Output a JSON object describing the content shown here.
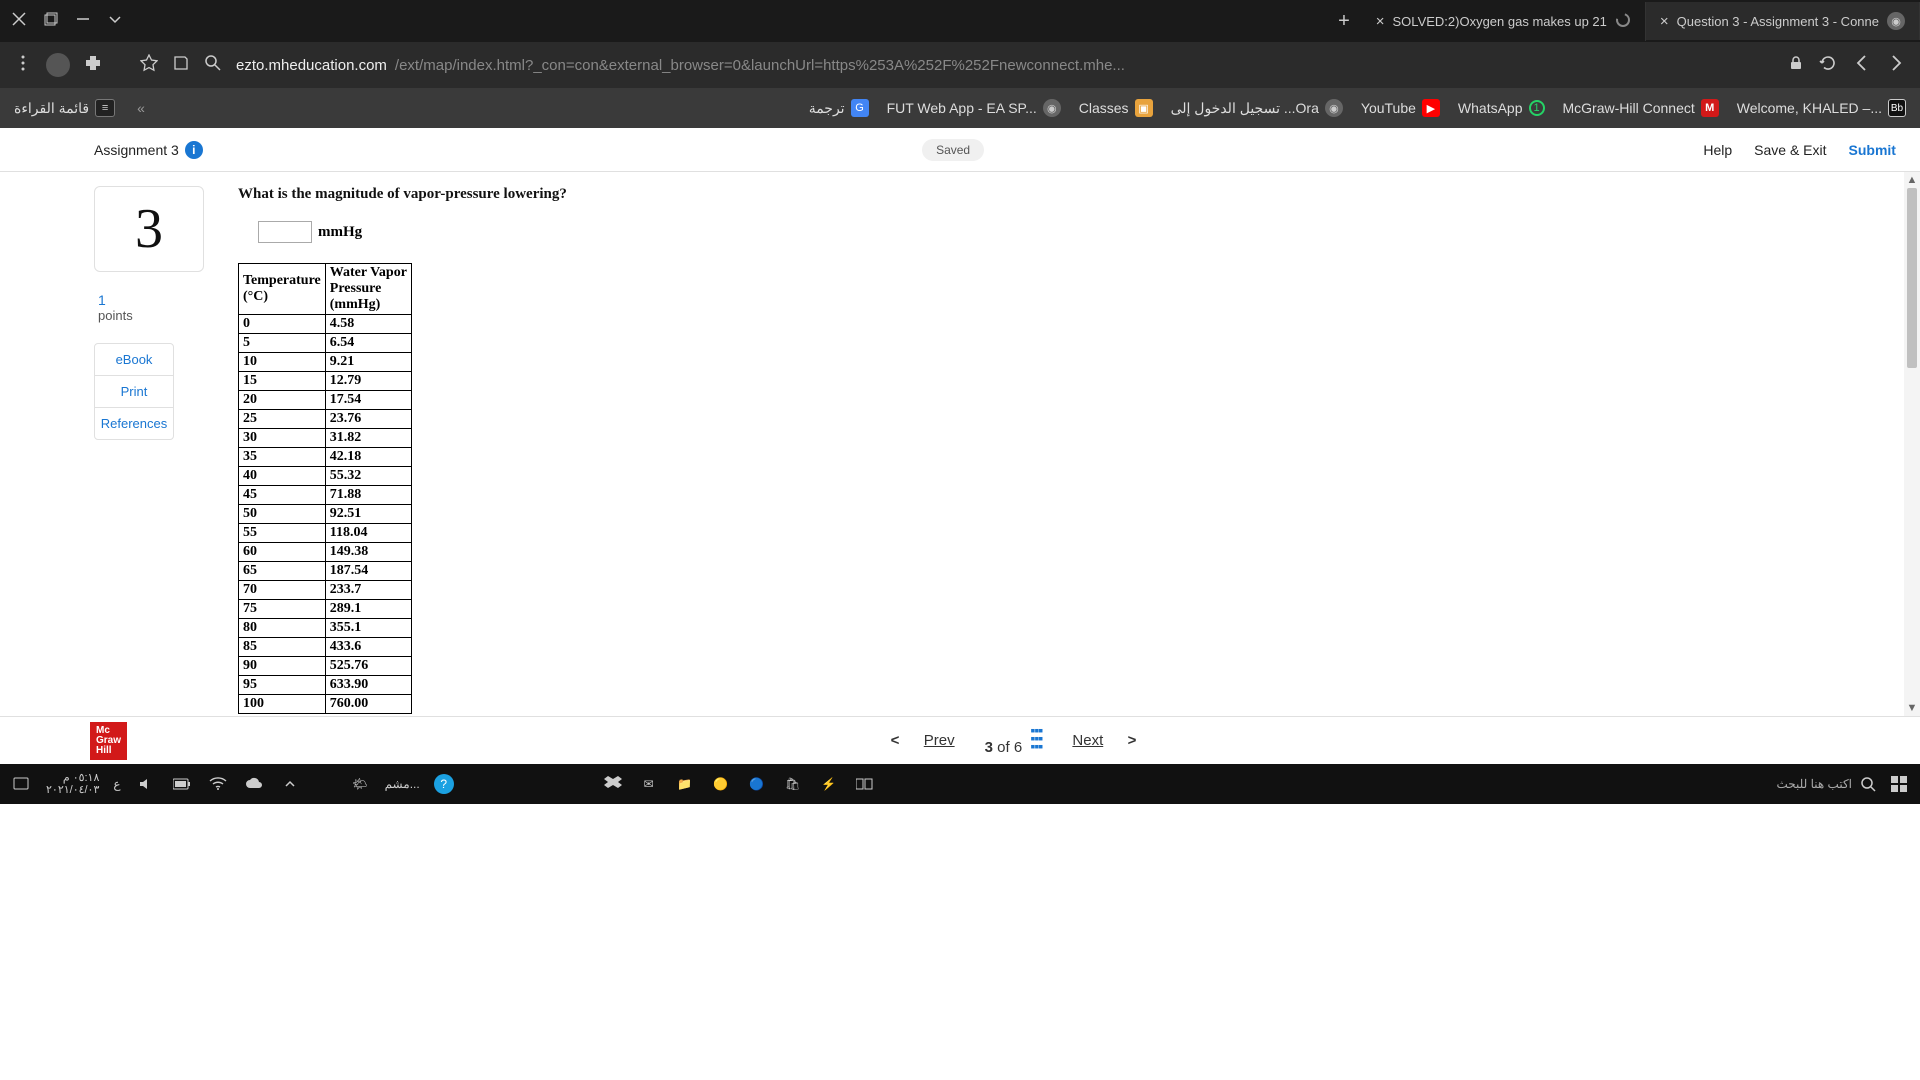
{
  "browser": {
    "tabs": [
      {
        "title": "SOLVED:2)Oxygen gas makes up 21",
        "active": false
      },
      {
        "title": "Question 3 - Assignment 3 - Conne",
        "active": true
      }
    ],
    "url_host": "ezto.mheducation.com",
    "url_path": "/ext/map/index.html?_con=con&external_browser=0&launchUrl=https%253A%252F%252Fnewconnect.mhe..."
  },
  "bookmarks": {
    "reading_list": "قائمة القراءة",
    "items": [
      {
        "label": "ترجمة"
      },
      {
        "label": "FUT Web App - EA SP..."
      },
      {
        "label": "Classes"
      },
      {
        "label": "تسجيل الدخول إلى ...Ora"
      },
      {
        "label": "YouTube"
      },
      {
        "label": "WhatsApp"
      },
      {
        "label": "McGraw-Hill Connect"
      },
      {
        "label": "Welcome, KHALED –..."
      }
    ]
  },
  "app": {
    "title": "Assignment 3",
    "saved": "Saved",
    "actions": {
      "help": "Help",
      "save_exit": "Save & Exit",
      "submit": "Submit"
    }
  },
  "question": {
    "number": "3",
    "points_value": "1",
    "points_label": "points",
    "links": {
      "ebook": "eBook",
      "print": "Print",
      "references": "References"
    },
    "text": "What is the magnitude of vapor-pressure lowering?",
    "unit": "mmHg",
    "table": {
      "head_temp": "Temperature (°C)",
      "head_vp": "Water Vapor Pressure (mmHg)",
      "rows": [
        [
          "0",
          "4.58"
        ],
        [
          "5",
          "6.54"
        ],
        [
          "10",
          "9.21"
        ],
        [
          "15",
          "12.79"
        ],
        [
          "20",
          "17.54"
        ],
        [
          "25",
          "23.76"
        ],
        [
          "30",
          "31.82"
        ],
        [
          "35",
          "42.18"
        ],
        [
          "40",
          "55.32"
        ],
        [
          "45",
          "71.88"
        ],
        [
          "50",
          "92.51"
        ],
        [
          "55",
          "118.04"
        ],
        [
          "60",
          "149.38"
        ],
        [
          "65",
          "187.54"
        ],
        [
          "70",
          "233.7"
        ],
        [
          "75",
          "289.1"
        ],
        [
          "80",
          "355.1"
        ],
        [
          "85",
          "433.6"
        ],
        [
          "90",
          "525.76"
        ],
        [
          "95",
          "633.90"
        ],
        [
          "100",
          "760.00"
        ]
      ]
    }
  },
  "pager": {
    "prev": "Prev",
    "pos": "3",
    "of": "of",
    "total": "6",
    "next": "Next"
  },
  "footer_logo": "Mc\nGraw\nHill",
  "taskbar": {
    "time": "٠٥:١٨ م",
    "date": "٢٠٢١/٠٤/٠٣",
    "lang": "ع",
    "weather": "مشم...",
    "search": "اكتب هنا للبحث"
  }
}
